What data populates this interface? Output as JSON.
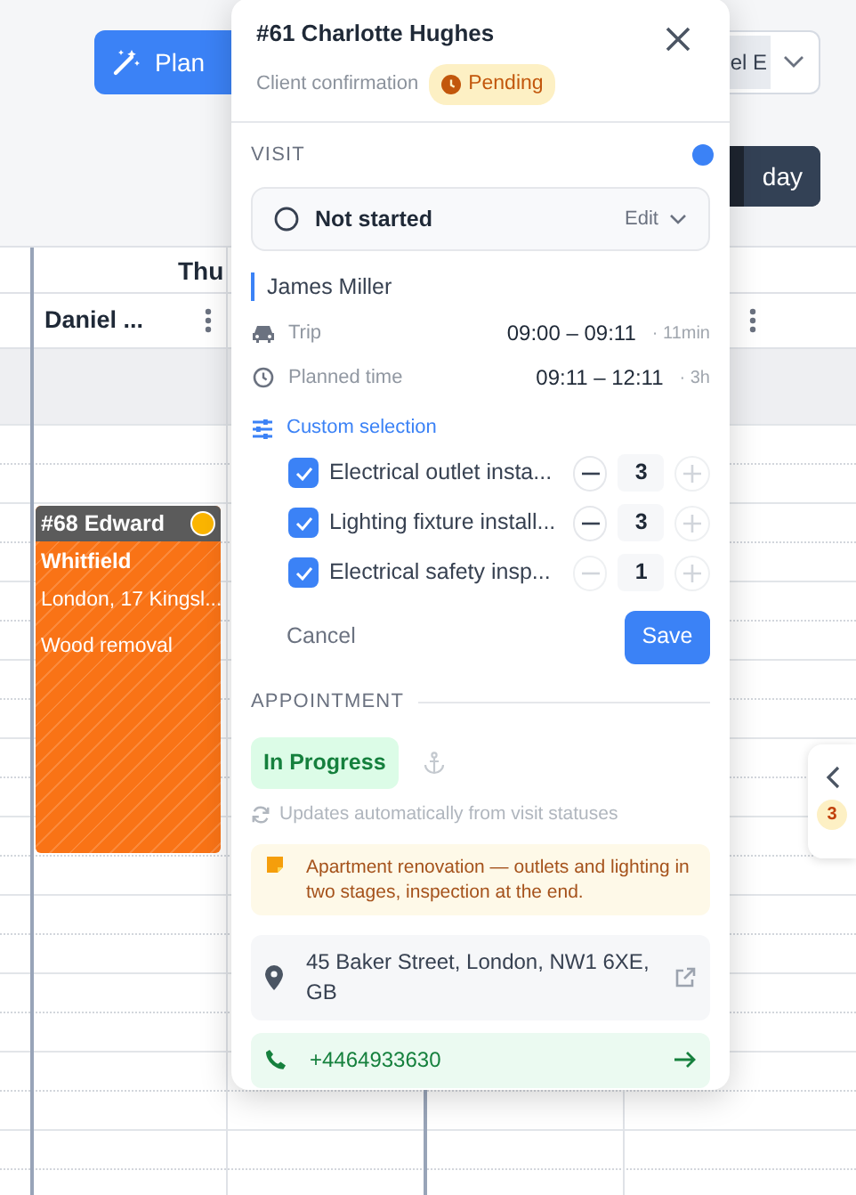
{
  "toolbar": {
    "plan_button": "Plan",
    "resource_select": {
      "value": "el E"
    },
    "view_button": "day"
  },
  "calendar": {
    "day_header": "Thu",
    "columns": [
      {
        "name": "Daniel ..."
      }
    ],
    "event": {
      "title": "#68 Edward",
      "title_cont": "Whitfield",
      "address": "London, 17 Kingsl...",
      "service": "Wood removal"
    }
  },
  "side_panel": {
    "badge": "3"
  },
  "popup": {
    "title": "#61 Charlotte Hughes",
    "confirmation_label": "Client confirmation",
    "confirmation_status": "Pending",
    "visit": {
      "section": "VISIT",
      "status": "Not started",
      "edit": "Edit",
      "technician": "James Miller",
      "trip": {
        "label": "Trip",
        "time": "09:00 – 09:11",
        "duration": "· 11min"
      },
      "planned": {
        "label": "Planned time",
        "time": "09:11 – 12:11",
        "duration": "· 3h"
      },
      "custom_label": "Custom selection",
      "services": [
        {
          "name": "Electrical outlet insta...",
          "checked": true,
          "quantity": "3",
          "can_decrease": true,
          "can_increase": false
        },
        {
          "name": "Lighting fixture install...",
          "checked": true,
          "quantity": "3",
          "can_decrease": true,
          "can_increase": false
        },
        {
          "name": "Electrical safety insp...",
          "checked": true,
          "quantity": "1",
          "can_decrease": false,
          "can_increase": false
        }
      ],
      "cancel": "Cancel",
      "save": "Save"
    },
    "appointment": {
      "section": "APPOINTMENT",
      "status": "In Progress",
      "note": "Updates automatically from visit statuses",
      "comment": "Apartment renovation — outlets and lighting in two stages, inspection at the end.",
      "address": "45 Baker Street, London, NW1 6XE, GB",
      "phone": "+4464933630"
    }
  }
}
